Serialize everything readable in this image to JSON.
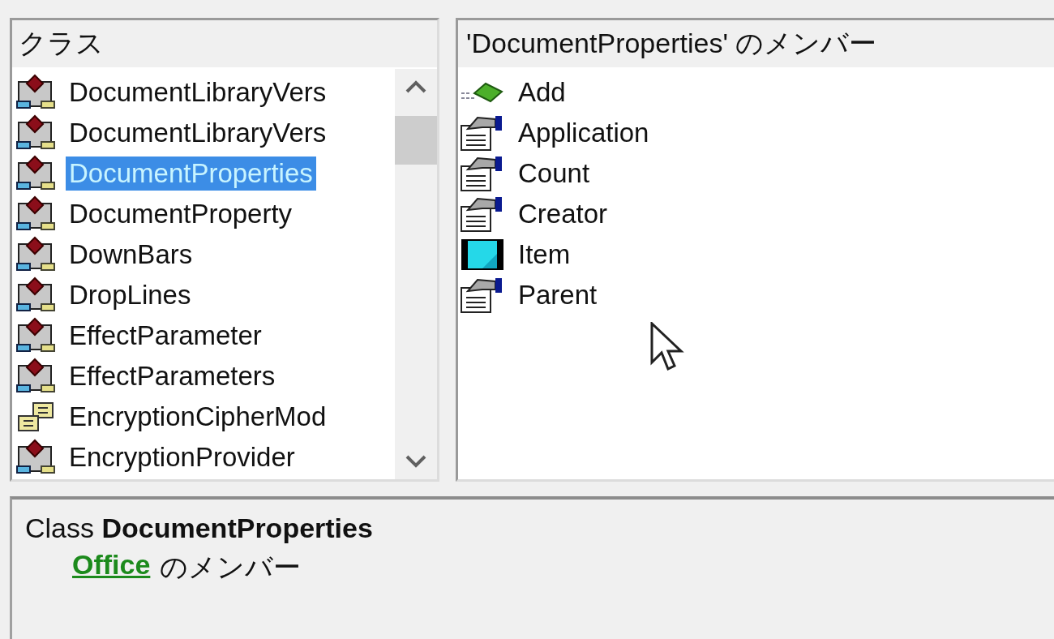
{
  "classes_pane": {
    "header": "クラス",
    "items": [
      {
        "kind": "class",
        "label": "DocumentLibraryVers",
        "selected": false
      },
      {
        "kind": "class",
        "label": "DocumentLibraryVers",
        "selected": false
      },
      {
        "kind": "class",
        "label": "DocumentProperties",
        "selected": true
      },
      {
        "kind": "class",
        "label": "DocumentProperty",
        "selected": false
      },
      {
        "kind": "class",
        "label": "DownBars",
        "selected": false
      },
      {
        "kind": "class",
        "label": "DropLines",
        "selected": false
      },
      {
        "kind": "class",
        "label": "EffectParameter",
        "selected": false
      },
      {
        "kind": "class",
        "label": "EffectParameters",
        "selected": false
      },
      {
        "kind": "enum",
        "label": "EncryptionCipherMod",
        "selected": false
      },
      {
        "kind": "class",
        "label": "EncryptionProvider",
        "selected": false
      }
    ]
  },
  "members_pane": {
    "header": "'DocumentProperties' のメンバー",
    "items": [
      {
        "kind": "method",
        "label": "Add"
      },
      {
        "kind": "property",
        "label": "Application"
      },
      {
        "kind": "property",
        "label": "Count"
      },
      {
        "kind": "property",
        "label": "Creator"
      },
      {
        "kind": "default",
        "label": "Item"
      },
      {
        "kind": "property",
        "label": "Parent"
      }
    ]
  },
  "details": {
    "title": "Class **DocumentProperties**",
    "library_link": "Office",
    "member_suffix": "のメンバー"
  }
}
